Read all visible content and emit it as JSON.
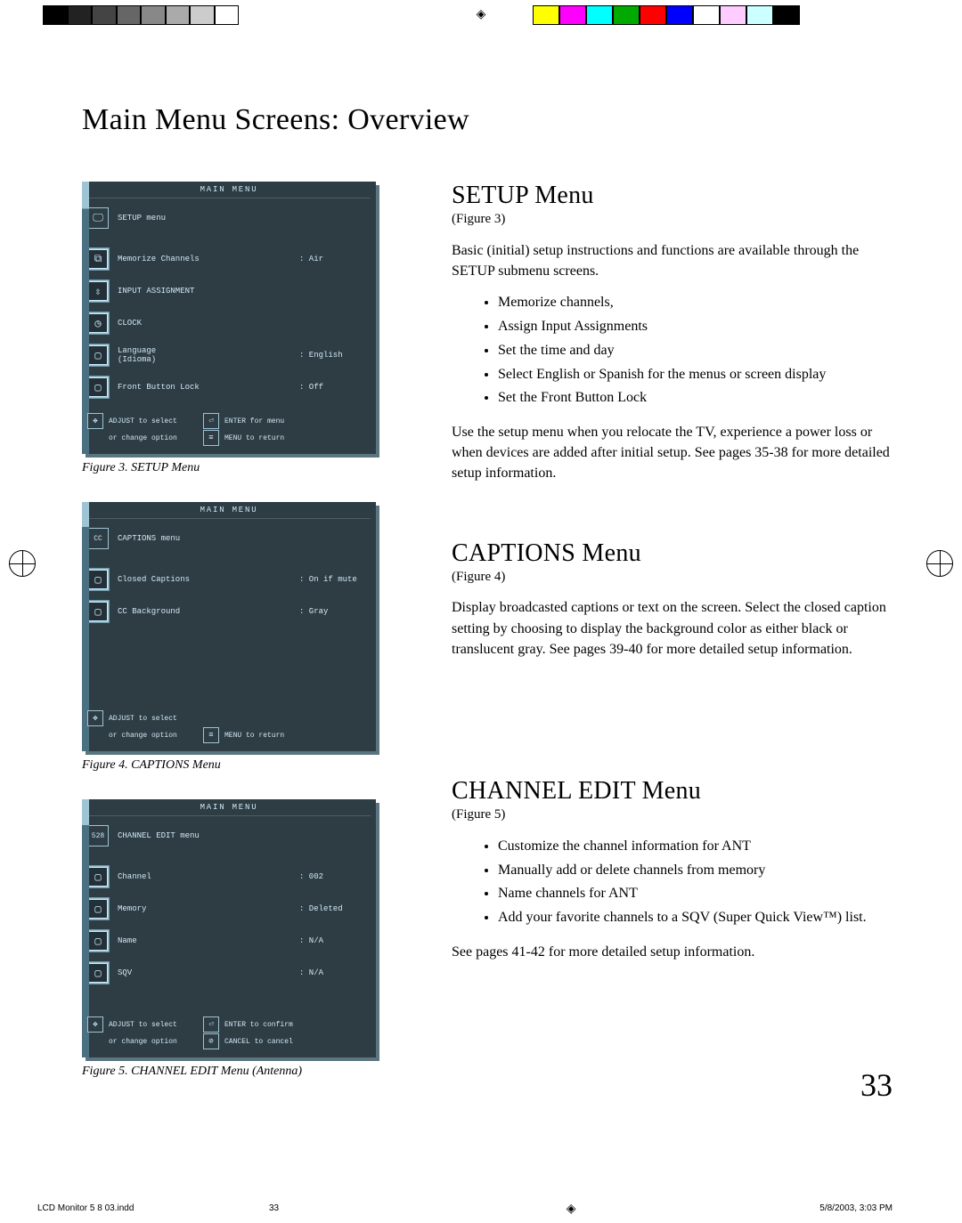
{
  "page_title": "Main Menu Screens: Overview",
  "page_number": "33",
  "footer": {
    "filename": "LCD Monitor 5 8 03.indd",
    "page": "33",
    "timestamp": "5/8/2003, 3:03 PM"
  },
  "figures": {
    "fig3": {
      "header": "MAIN MENU",
      "caption": "Figure 3.  SETUP Menu",
      "rows": [
        {
          "icon": "monitor",
          "label": "SETUP menu",
          "value": ""
        },
        {
          "icon": "channels",
          "label": "Memorize Channels",
          "value": ": Air"
        },
        {
          "icon": "updown",
          "label": "INPUT ASSIGNMENT",
          "value": ""
        },
        {
          "icon": "clock",
          "label": "CLOCK",
          "value": ""
        },
        {
          "icon": "box",
          "label": "Language\n(Idioma)",
          "value": ": English"
        },
        {
          "icon": "box",
          "label": "Front Button Lock",
          "value": ": Off"
        }
      ],
      "footer": [
        {
          "icon": "nav",
          "text1": "ADJUST to select",
          "icon2": "enter",
          "text2": "ENTER for menu"
        },
        {
          "icon": "empty",
          "text1": "or change option",
          "icon2": "menu",
          "text2": "MENU to return"
        }
      ]
    },
    "fig4": {
      "header": "MAIN MENU",
      "caption": "Figure 4.  CAPTIONS Menu",
      "rows": [
        {
          "icon": "cc",
          "label": "CAPTIONS menu",
          "value": ""
        },
        {
          "icon": "box",
          "label": "Closed Captions",
          "value": ": On if mute"
        },
        {
          "icon": "box",
          "label": "CC Background",
          "value": ": Gray"
        }
      ],
      "footer": [
        {
          "icon": "nav",
          "text1": "ADJUST to select",
          "icon2": "empty",
          "text2": ""
        },
        {
          "icon": "empty",
          "text1": "or change option",
          "icon2": "menu",
          "text2": "MENU to return"
        }
      ]
    },
    "fig5": {
      "header": "MAIN MENU",
      "caption": "Figure 5.  CHANNEL EDIT  Menu (Antenna)",
      "rows": [
        {
          "icon": "528",
          "label": "CHANNEL EDIT menu",
          "value": ""
        },
        {
          "icon": "box",
          "label": "Channel",
          "value": ": 002"
        },
        {
          "icon": "box",
          "label": "Memory",
          "value": ": Deleted"
        },
        {
          "icon": "box",
          "label": "Name",
          "value": ": N/A"
        },
        {
          "icon": "box",
          "label": "SQV",
          "value": ": N/A"
        }
      ],
      "footer": [
        {
          "icon": "nav",
          "text1": "ADJUST to select",
          "icon2": "enter",
          "text2": "ENTER to confirm"
        },
        {
          "icon": "empty",
          "text1": "or change option",
          "icon2": "cancel",
          "text2": "CANCEL to cancel"
        }
      ]
    }
  },
  "setup": {
    "heading": "SETUP Menu",
    "figref": "(Figure 3)",
    "intro": "Basic (initial) setup instructions and functions are available through the SETUP submenu screens.",
    "bullets": [
      "Memorize channels,",
      "Assign Input Assignments",
      "Set the time and day",
      "Select English or Spanish for the menus or screen display",
      "Set the Front Button Lock"
    ],
    "outro": "Use the setup menu when you relocate the TV, experience a power loss or when devices are added after initial setup.  See pages 35-38 for more detailed setup information."
  },
  "captions": {
    "heading": "CAPTIONS Menu",
    "figref": "(Figure 4)",
    "body": "Display broadcasted captions or text on the screen.  Select the closed caption setting by choosing to display the background color as either black or translucent gray.  See pages 39-40 for more detailed setup information."
  },
  "chedit": {
    "heading": "CHANNEL EDIT Menu",
    "figref": "(Figure 5)",
    "bullets": [
      "Customize the channel information for ANT",
      "Manually add or delete channels from memory",
      "Name channels for ANT",
      "Add your favorite channels to a SQV (Super Quick View™) list."
    ],
    "outro": "See pages 41-42 for more detailed setup information."
  }
}
